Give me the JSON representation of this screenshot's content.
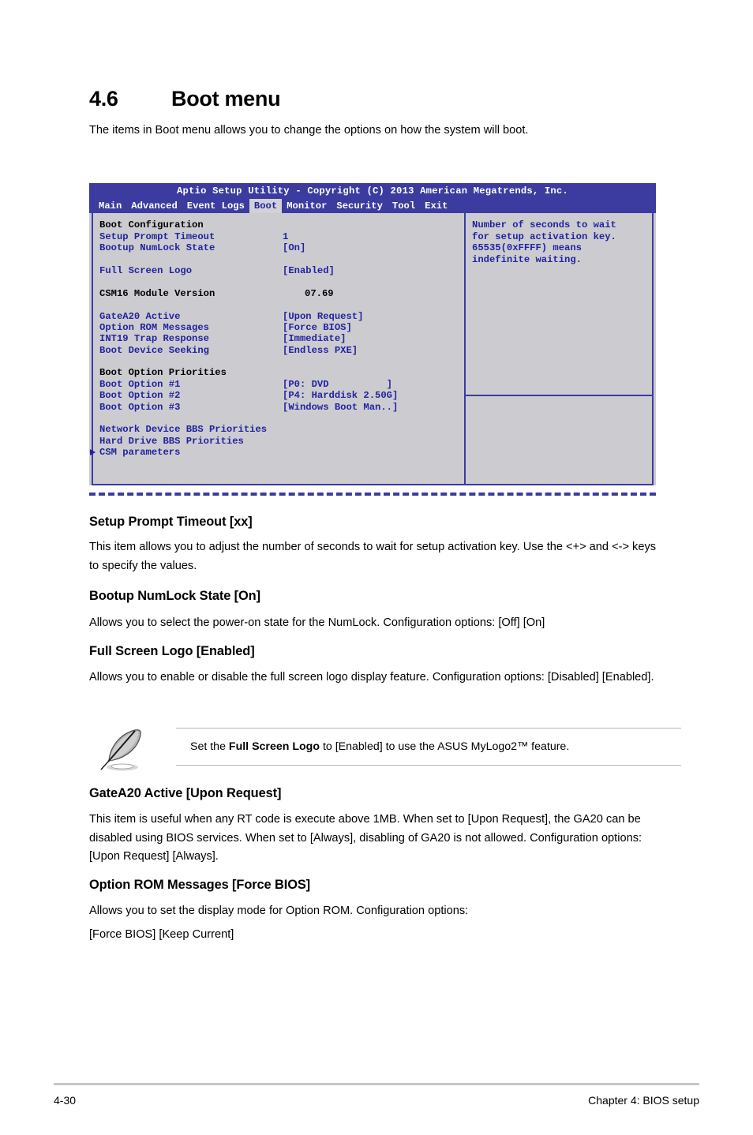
{
  "section": {
    "number": "4.6",
    "title": "Boot menu",
    "intro": "The items in Boot menu allows you to change the options on how the system will boot."
  },
  "bios": {
    "title": "Aptio Setup Utility - Copyright (C) 2013 American Megatrends, Inc.",
    "tabs": [
      {
        "label": "Main",
        "active": false
      },
      {
        "label": "Advanced",
        "active": false
      },
      {
        "label": "Event Logs",
        "active": false
      },
      {
        "label": "Boot",
        "active": true
      },
      {
        "label": "Monitor",
        "active": false
      },
      {
        "label": "Security",
        "active": false
      },
      {
        "label": "Tool",
        "active": false
      },
      {
        "label": "Exit",
        "active": false
      }
    ],
    "group_boot_configuration": "Boot Configuration",
    "setup_prompt_timeout_label": "Setup Prompt Timeout",
    "setup_prompt_timeout_value": "1",
    "bootup_numlock_label": "Bootup NumLock State",
    "bootup_numlock_value": "[On]",
    "full_screen_logo_label": "Full Screen Logo",
    "full_screen_logo_value": "[Enabled]",
    "csm16_label": "CSM16 Module Version",
    "csm16_value": "07.69",
    "gatea20_label": "GateA20 Active",
    "gatea20_value": "[Upon Request]",
    "option_rom_label": "Option ROM Messages",
    "option_rom_value": "[Force BIOS]",
    "int19_label": "INT19 Trap Response",
    "int19_value": "[Immediate]",
    "boot_device_seeking_label": "Boot Device Seeking",
    "boot_device_seeking_value": "[Endless PXE]",
    "group_boot_option_priorities": "Boot Option Priorities",
    "boot_option_1_label": "Boot Option #1",
    "boot_option_1_value": "[P0: DVD          ]",
    "boot_option_2_label": "Boot Option #2",
    "boot_option_2_value": "[P4: Harddisk 2.50G]",
    "boot_option_3_label": "Boot Option #3",
    "boot_option_3_value": "[Windows Boot Man..]",
    "network_bbs": "Network Device BBS Priorities",
    "hard_drive_bbs": "Hard Drive BBS Priorities",
    "csm_parameters": "CSM parameters",
    "help_line_1": "Number of seconds to wait",
    "help_line_2": "for setup activation key.",
    "help_line_3": "65535(0xFFFF) means",
    "help_line_4": "indefinite waiting.",
    "colors": {
      "header_blue": "#3b3ba0",
      "text_blue": "#2222a0",
      "panel_bg": "#ccccd0",
      "tab_active_bg": "#d2d2d6"
    }
  },
  "items": [
    {
      "heading": "Setup Prompt Timeout [xx]",
      "body": "This item allows you to adjust the number of seconds to wait for setup activation key. Use the <+> and <-> keys to specify the values."
    },
    {
      "heading": "Bootup NumLock State [On]",
      "body": "Allows you to select the power-on state for the NumLock. Configuration options: [Off] [On]"
    },
    {
      "heading": "Full Screen Logo [Enabled]",
      "body": "Allows you to enable or disable the full screen logo display feature. Configuration options: [Disabled] [Enabled]."
    },
    {
      "heading": "GateA20 Active [Upon Request]",
      "body": "This item is useful when any RT code is execute above 1MB. When set to [Upon Request], the GA20 can be disabled using BIOS services. When set to [Always], disabling of GA20 is not allowed. Configuration options: [Upon Request] [Always]."
    },
    {
      "heading": "Option ROM Messages [Force BIOS]",
      "body": "Allows you to set the display mode for Option ROM. Configuration options:",
      "body2": "[Force BIOS] [Keep Current]"
    }
  ],
  "note": {
    "text_before": "Set the ",
    "text_bold": "Full Screen Logo",
    "text_after": " to [Enabled] to use the ASUS MyLogo2™ feature.",
    "icon": "quill-pen-icon"
  },
  "footer": {
    "page_number": "4-30",
    "chapter": "Chapter 4: BIOS setup"
  }
}
